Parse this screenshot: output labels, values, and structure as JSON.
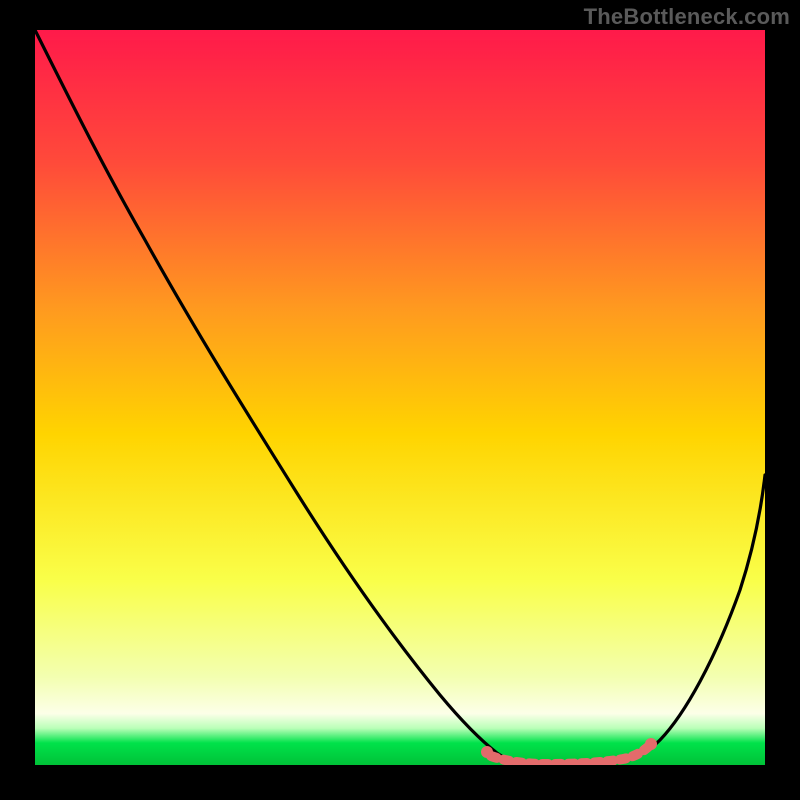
{
  "watermark": "TheBottleneck.com",
  "colors": {
    "background": "#000000",
    "gradient_top": "#ff1a4a",
    "gradient_upper_mid": "#ff7a1f",
    "gradient_mid": "#ffd400",
    "gradient_lower_mid": "#f7ff6a",
    "gradient_bottom_yellow": "#fbffd6",
    "gradient_green": "#00e24a",
    "curve": "#000000",
    "accent_pink": "#e36b6b"
  },
  "chart_data": {
    "type": "line",
    "title": "",
    "xlabel": "",
    "ylabel": "",
    "xlim": [
      0,
      100
    ],
    "ylim": [
      0,
      100
    ],
    "grid": false,
    "legend": false,
    "series": [
      {
        "name": "bottleneck-curve",
        "x": [
          0,
          5,
          10,
          15,
          20,
          25,
          30,
          35,
          40,
          45,
          50,
          55,
          60,
          62,
          65,
          70,
          75,
          80,
          82,
          85,
          90,
          95,
          100
        ],
        "y": [
          100,
          92,
          84,
          76,
          68,
          61,
          53,
          45,
          37,
          29,
          21,
          13,
          6,
          3,
          1,
          0,
          0,
          1,
          3,
          7,
          16,
          27,
          40
        ]
      }
    ],
    "accent_region": {
      "name": "optimal-band",
      "x_start": 60,
      "x_end": 82,
      "y": 0
    }
  }
}
